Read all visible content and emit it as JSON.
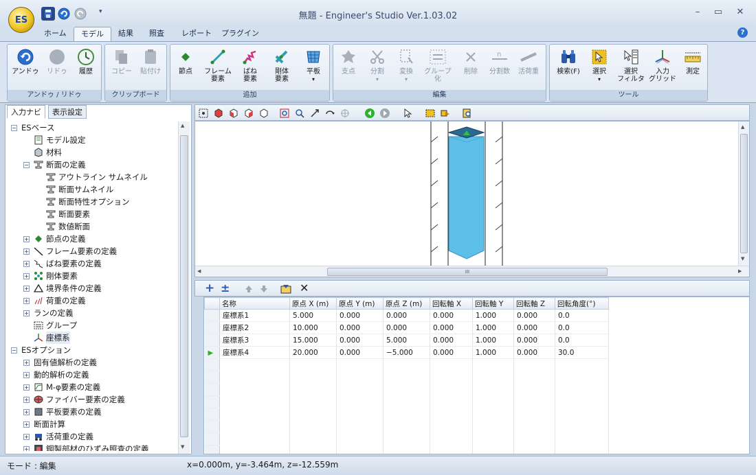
{
  "window": {
    "title": "無題 - Engineer's Studio Ver.1.03.02",
    "logo": "ES",
    "buttons": {
      "min": "–",
      "max": "▭",
      "close": "✕"
    }
  },
  "quick_access": {
    "icons": [
      "save-icon",
      "undo-icon",
      "redo-icon",
      "dropdown-icon"
    ],
    "dropdown": "▾"
  },
  "tabs": [
    "ホーム",
    "モデル",
    "結果",
    "照査",
    "レポート",
    "プラグイン"
  ],
  "help": "?",
  "ribbon": {
    "groups": [
      {
        "label": "アンドゥ / リドゥ",
        "buttons": [
          "アンドゥ",
          "リドゥ",
          "履歴"
        ]
      },
      {
        "label": "クリップボード",
        "buttons": [
          "コピー",
          "貼付け"
        ]
      },
      {
        "label": "追加",
        "buttons": [
          "節点",
          "フレーム\n要素",
          "ばね\n要素",
          "剛体\n要素",
          "平板"
        ]
      },
      {
        "label": "編集",
        "buttons": [
          "支点",
          "分割",
          "変換",
          "グループ\n化",
          "削除",
          "分割数",
          "活荷重"
        ]
      },
      {
        "label": "ツール",
        "buttons": [
          "検索(F)",
          "選択",
          "選択\nフィルタ",
          "入力\nグリッド",
          "測定"
        ]
      }
    ],
    "dropdown_arrow": "▾"
  },
  "left_panel": {
    "tabs": [
      "入力ナビ",
      "表示設定"
    ],
    "tree": [
      {
        "level": 0,
        "exp": "−",
        "label": "ESベース",
        "icon": ""
      },
      {
        "level": 1,
        "exp": "",
        "label": "モデル設定",
        "icon": "model-settings-icon"
      },
      {
        "level": 1,
        "exp": "",
        "label": "材料",
        "icon": "material-icon"
      },
      {
        "level": 1,
        "exp": "−",
        "label": "断面の定義",
        "icon": "section-icon"
      },
      {
        "level": 2,
        "exp": "",
        "label": "アウトライン サムネイル",
        "icon": "section-icon"
      },
      {
        "level": 2,
        "exp": "",
        "label": "断面サムネイル",
        "icon": "section-icon"
      },
      {
        "level": 2,
        "exp": "",
        "label": "断面特性オプション",
        "icon": "section-icon"
      },
      {
        "level": 2,
        "exp": "",
        "label": "断面要素",
        "icon": "section-icon"
      },
      {
        "level": 2,
        "exp": "",
        "label": "数値断面",
        "icon": "section-icon"
      },
      {
        "level": 1,
        "exp": "+",
        "label": "節点の定義",
        "icon": "node-icon"
      },
      {
        "level": 1,
        "exp": "+",
        "label": "フレーム要素の定義",
        "icon": "frame-icon"
      },
      {
        "level": 1,
        "exp": "+",
        "label": "ばね要素の定義",
        "icon": "spring-icon"
      },
      {
        "level": 1,
        "exp": "+",
        "label": "剛体要素",
        "icon": "rigid-icon"
      },
      {
        "level": 1,
        "exp": "+",
        "label": "境界条件の定義",
        "icon": "support-icon"
      },
      {
        "level": 1,
        "exp": "+",
        "label": "荷重の定義",
        "icon": "load-icon"
      },
      {
        "level": 1,
        "exp": "+",
        "label": "ランの定義",
        "icon": ""
      },
      {
        "level": 1,
        "exp": "",
        "label": "グループ",
        "icon": "group-icon"
      },
      {
        "level": 1,
        "exp": "",
        "label": "座標系",
        "icon": "axes-icon",
        "selected": true
      },
      {
        "level": 0,
        "exp": "−",
        "label": "ESオプション",
        "icon": ""
      },
      {
        "level": 1,
        "exp": "+",
        "label": "固有値解析の定義",
        "icon": ""
      },
      {
        "level": 1,
        "exp": "+",
        "label": "動的解析の定義",
        "icon": ""
      },
      {
        "level": 1,
        "exp": "+",
        "label": "M-φ要素の定義",
        "icon": "mphi-icon"
      },
      {
        "level": 1,
        "exp": "+",
        "label": "ファイバー要素の定義",
        "icon": "fiber-icon"
      },
      {
        "level": 1,
        "exp": "+",
        "label": "平板要素の定義",
        "icon": "plate-icon"
      },
      {
        "level": 1,
        "exp": "+",
        "label": "断面計算",
        "icon": ""
      },
      {
        "level": 1,
        "exp": "+",
        "label": "活荷重の定義",
        "icon": "liveload-icon"
      },
      {
        "level": 1,
        "exp": "+",
        "label": "鋼製部材のひずみ照査の定義",
        "icon": "steel-icon"
      }
    ]
  },
  "grid": {
    "columns": [
      "名称",
      "原点 X (m)",
      "原点 Y (m)",
      "原点 Z (m)",
      "回転軸 X",
      "回転軸 Y",
      "回転軸 Z",
      "回転角度(°)"
    ],
    "rows": [
      [
        "座標系1",
        "5.000",
        "0.000",
        "0.000",
        "0.000",
        "1.000",
        "0.000",
        "0.0"
      ],
      [
        "座標系2",
        "10.000",
        "0.000",
        "0.000",
        "0.000",
        "1.000",
        "0.000",
        "0.0"
      ],
      [
        "座標系3",
        "15.000",
        "0.000",
        "5.000",
        "0.000",
        "1.000",
        "0.000",
        "0.0"
      ],
      [
        "座標系4",
        "20.000",
        "0.000",
        "−5.000",
        "0.000",
        "1.000",
        "0.000",
        "30.0"
      ]
    ],
    "current_row": 3,
    "current_marker": "▶",
    "toolbar": {
      "add": "+",
      "insert": "±",
      "delete": "✕"
    }
  },
  "view": {
    "scroll_grip": "III",
    "arrows": {
      "up": "▲",
      "down": "▼",
      "left": "◀",
      "right": "▶"
    }
  },
  "status": {
    "mode": "モード : 編集",
    "coords": "x=0.000m, y=-3.464m, z=-12.559m"
  },
  "colors": {
    "accent": "#2060c0",
    "column": "#5cc0e8",
    "column_top": "#2a6a90"
  }
}
